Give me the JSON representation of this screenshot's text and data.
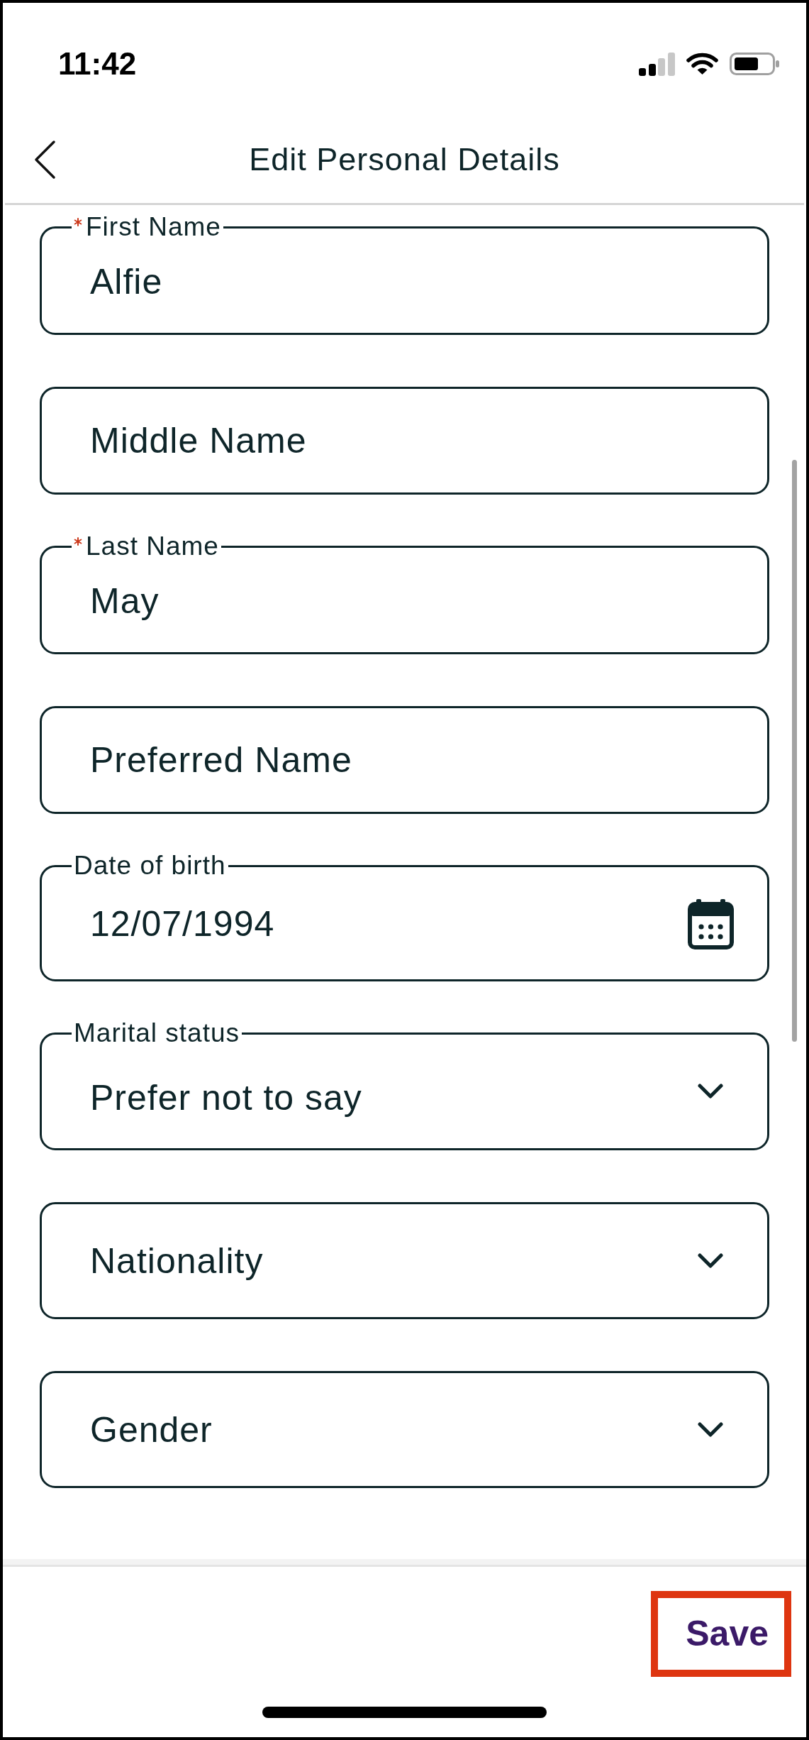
{
  "status_bar": {
    "time": "11:42"
  },
  "header": {
    "title": "Edit Personal Details"
  },
  "fields": [
    {
      "kind": "text",
      "label": "First Name",
      "required": true,
      "value": "Alfie"
    },
    {
      "kind": "text",
      "placeholder": "Middle Name"
    },
    {
      "kind": "text",
      "label": "Last Name",
      "required": true,
      "value": "May"
    },
    {
      "kind": "text",
      "placeholder": "Preferred Name"
    },
    {
      "kind": "date",
      "label": "Date of birth",
      "required": false,
      "value": "12/07/1994"
    },
    {
      "kind": "select",
      "label": "Marital status",
      "required": false,
      "value": "Prefer not to say"
    },
    {
      "kind": "select",
      "placeholder": "Nationality"
    },
    {
      "kind": "select",
      "placeholder": "Gender"
    }
  ],
  "footer": {
    "save_button": {
      "label": "Save",
      "highlighted": true
    }
  }
}
